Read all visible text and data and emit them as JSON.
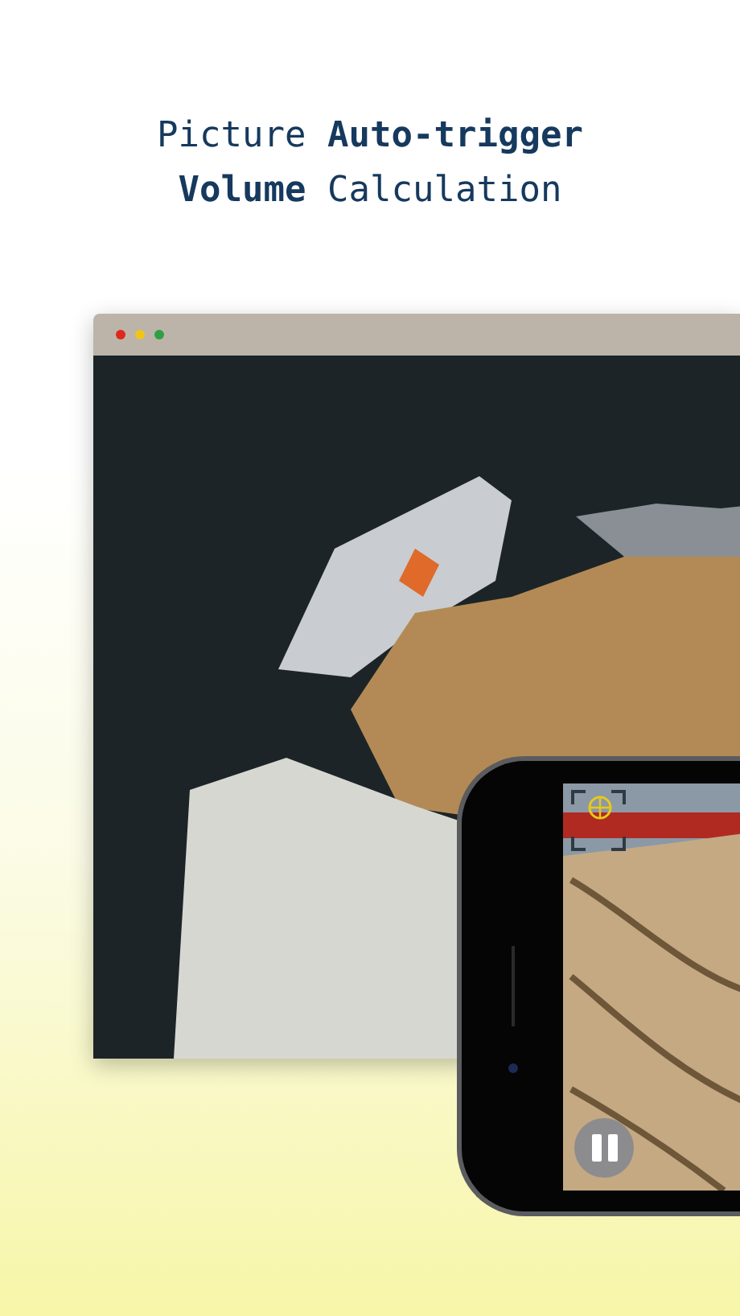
{
  "headline": [
    "Picture **Auto-trigger**",
    "**Volume** Calculation"
  ],
  "window": {
    "controls": [
      {
        "color": "#e0261d"
      },
      {
        "color": "#f0c419"
      },
      {
        "color": "#2ea043"
      }
    ]
  }
}
